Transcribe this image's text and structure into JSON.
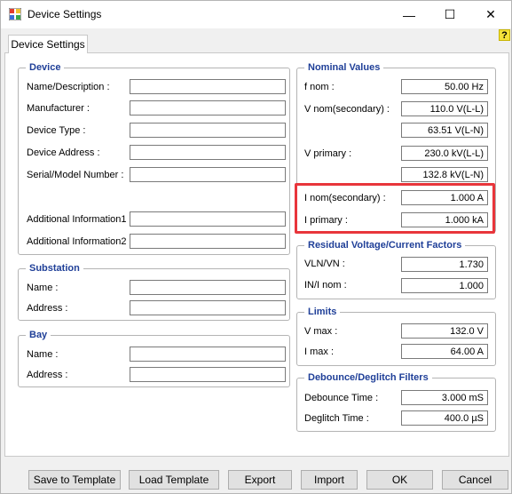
{
  "window": {
    "title": "Device Settings",
    "minimize": "—",
    "maximize": "☐",
    "close": "✕",
    "help": "?"
  },
  "tab": {
    "label": "Device Settings"
  },
  "device": {
    "legend": "Device",
    "fields": [
      {
        "label": "Name/Description :",
        "value": ""
      },
      {
        "label": "Manufacturer :",
        "value": ""
      },
      {
        "label": "Device Type :",
        "value": ""
      },
      {
        "label": "Device Address :",
        "value": ""
      },
      {
        "label": "Serial/Model Number :",
        "value": ""
      },
      {
        "label": "Additional Information1 :",
        "value": ""
      },
      {
        "label": "Additional Information2 :",
        "value": ""
      }
    ]
  },
  "substation": {
    "legend": "Substation",
    "fields": [
      {
        "label": "Name :",
        "value": ""
      },
      {
        "label": "Address :",
        "value": ""
      }
    ]
  },
  "bay": {
    "legend": "Bay",
    "fields": [
      {
        "label": "Name :",
        "value": ""
      },
      {
        "label": "Address :",
        "value": ""
      }
    ]
  },
  "nominal": {
    "legend": "Nominal Values",
    "f_nom": {
      "label": "f nom :",
      "value": "50.00 Hz"
    },
    "v_nom_sec": {
      "label": "V nom(secondary) :",
      "value": "110.0 V(L-L)",
      "value2": "63.51 V(L-N)"
    },
    "v_primary": {
      "label": "V primary :",
      "value": "230.0 kV(L-L)",
      "value2": "132.8 kV(L-N)"
    },
    "i_nom_sec": {
      "label": "I nom(secondary) :",
      "value": "1.000 A"
    },
    "i_primary": {
      "label": "I primary :",
      "value": "1.000 kA"
    }
  },
  "residual": {
    "legend": "Residual Voltage/Current Factors",
    "vln_vn": {
      "label": "VLN/VN :",
      "value": "1.730"
    },
    "in_inom": {
      "label": "IN/I nom :",
      "value": "1.000"
    }
  },
  "limits": {
    "legend": "Limits",
    "vmax": {
      "label": "V max :",
      "value": "132.0 V"
    },
    "imax": {
      "label": "I max :",
      "value": "64.00 A"
    }
  },
  "debounce": {
    "legend": "Debounce/Deglitch Filters",
    "debounce_time": {
      "label": "Debounce Time :",
      "value": "3.000 mS"
    },
    "deglitch_time": {
      "label": "Deglitch Time :",
      "value": "400.0 µS"
    }
  },
  "buttons": {
    "save_template": "Save to Template",
    "load_template": "Load Template",
    "export": "Export",
    "import": "Import",
    "ok": "OK",
    "cancel": "Cancel"
  },
  "colors": {
    "legend": "#1f3f98",
    "highlight": "#e8353b"
  }
}
